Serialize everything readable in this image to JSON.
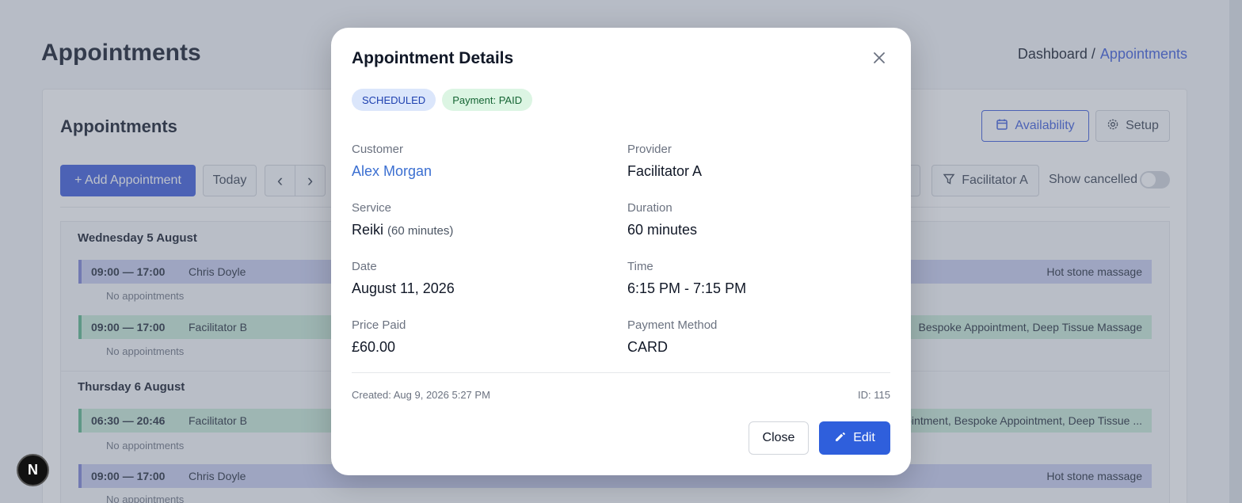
{
  "page": {
    "title": "Appointments",
    "breadcrumb": {
      "root": "Dashboard /",
      "current": "Appointments"
    }
  },
  "card": {
    "title": "Appointments",
    "availability_label": "Availability",
    "setup_label": "Setup",
    "add_label": "+ Add Appointment",
    "today_label": "Today",
    "prev_label": "‹",
    "next_label": "›",
    "facilitator_filter_label": "Facilitator A",
    "show_cancelled_label": "Show cancelled"
  },
  "schedule": {
    "days": [
      {
        "label": "Wednesday 5 August",
        "slots": [
          {
            "time": "09:00 — 17:00",
            "who": "Chris Doyle",
            "services": "Hot stone massage",
            "color": "purple",
            "empty": "No appointments"
          },
          {
            "time": "09:00 — 17:00",
            "who": "Facilitator B",
            "services": "Bespoke Appointment, Deep Tissue Massage",
            "color": "green",
            "empty": "No appointments"
          }
        ]
      },
      {
        "label": "Thursday 6 August",
        "slots": [
          {
            "time": "06:30 — 20:46",
            "who": "Facilitator B",
            "services": "ppointment, Bespoke Appointment, Deep Tissue ...",
            "color": "green",
            "empty": "No appointments"
          },
          {
            "time": "09:00 — 17:00",
            "who": "Chris Doyle",
            "services": "Hot stone massage",
            "color": "purple",
            "empty": "No appointments"
          }
        ]
      }
    ]
  },
  "modal": {
    "title": "Appointment Details",
    "status_badge": "SCHEDULED",
    "payment_badge": "Payment: PAID",
    "fields": {
      "customer_label": "Customer",
      "customer_value": "Alex Morgan",
      "provider_label": "Provider",
      "provider_value": "Facilitator A",
      "service_label": "Service",
      "service_value": "Reiki",
      "service_duration": "(60 minutes)",
      "duration_label": "Duration",
      "duration_value": "60 minutes",
      "date_label": "Date",
      "date_value": "August 11, 2026",
      "time_label": "Time",
      "time_value": "6:15 PM - 7:15 PM",
      "price_label": "Price Paid",
      "price_value": "£60.00",
      "method_label": "Payment Method",
      "method_value": "CARD"
    },
    "created": "Created: Aug 9, 2026 5:27 PM",
    "id": "ID: 115",
    "close_label": "Close",
    "edit_label": "Edit"
  },
  "colors": {
    "accent": "#3b5bdb",
    "edit_button": "#2f5fdc",
    "link": "#3b6fd1"
  }
}
